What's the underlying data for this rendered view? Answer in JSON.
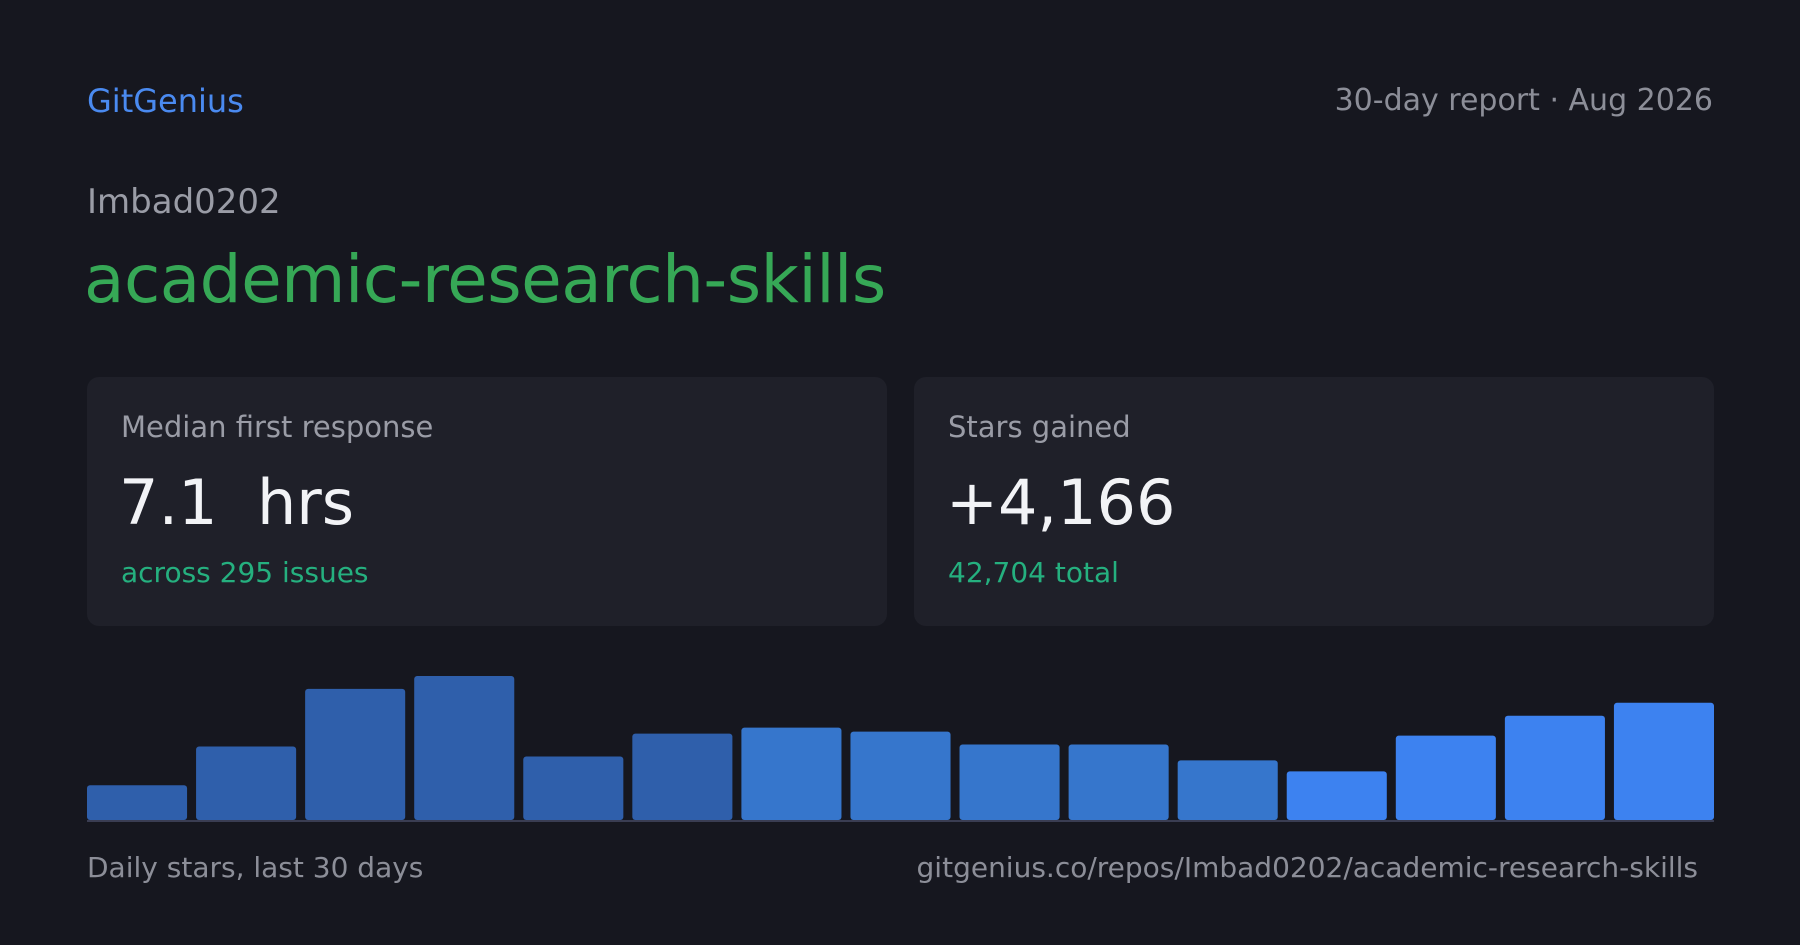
{
  "header": {
    "brand": "GitGenius",
    "report_label": "30-day report · Aug 2026"
  },
  "repo": {
    "owner": "Imbad0202",
    "name": "academic-research-skills"
  },
  "cards": [
    {
      "label": "Median first response",
      "value": "7.1  hrs",
      "sub": "across 295 issues"
    },
    {
      "label": "Stars gained",
      "value": "+4,166",
      "sub": "42,704 total"
    }
  ],
  "footer": {
    "caption": "Daily stars, last 30 days",
    "url": "gitgenius.co/repos/Imbad0202/academic-research-skills"
  },
  "chart_data": {
    "type": "bar",
    "title": "",
    "xlabel": "",
    "ylabel": "",
    "grid": false,
    "legend": "none",
    "ylim": [
      0,
      145
    ],
    "values": [
      35,
      74,
      132,
      145,
      64,
      87,
      93,
      89,
      76,
      76,
      60,
      49,
      85,
      105,
      118
    ],
    "colors": [
      "#2f5fab",
      "#2f5fab",
      "#2f5fab",
      "#2f5fab",
      "#2f5fab",
      "#2f5fab",
      "#3676cc",
      "#3676cc",
      "#3676cc",
      "#3676cc",
      "#3676cc",
      "#3d82f0",
      "#3d82f0",
      "#3d82f0",
      "#3d82f0"
    ],
    "baseline_color": "#3a3d52"
  }
}
